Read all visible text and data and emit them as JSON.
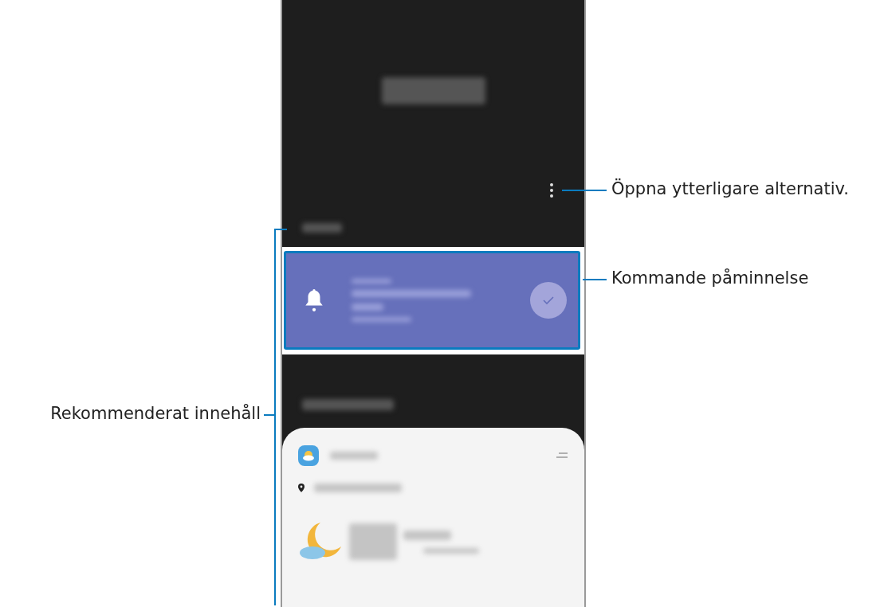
{
  "callouts": [
    {
      "label": "Öppna ytterligare alternativ.",
      "kind": "right"
    },
    {
      "label": "Kommande påminnelse",
      "kind": "right"
    },
    {
      "label": "Rekommenderat innehåll",
      "kind": "left"
    }
  ]
}
